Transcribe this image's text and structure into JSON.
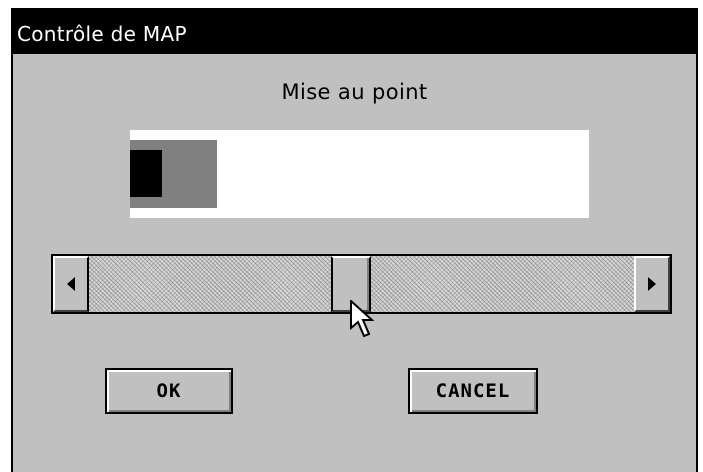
{
  "window": {
    "title": "Contrôle de MAP"
  },
  "focus": {
    "label": "Mise au point",
    "meter_level_percent": 19,
    "meter_peak_percent": 7
  },
  "slider": {
    "value_percent": 48
  },
  "buttons": {
    "ok_label": "OK",
    "cancel_label": "CANCEL"
  },
  "icons": {
    "scroll_left": "arrow-left-icon",
    "scroll_right": "arrow-right-icon",
    "pointer": "mouse-pointer-icon"
  },
  "colors": {
    "titlebar": "#000000",
    "window_bg": "#c0c0c0",
    "meter_level": "#808080",
    "meter_peak": "#000000"
  }
}
